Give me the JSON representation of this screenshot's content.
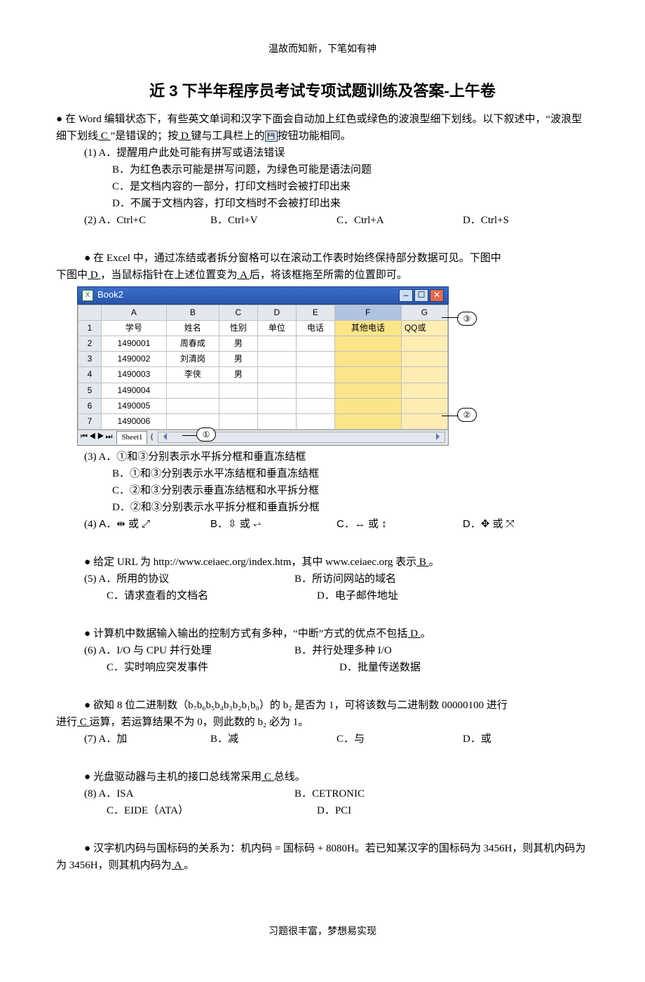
{
  "header_note": "温故而知新，下笔如有神",
  "footer_note": "习题很丰富，梦想易实现",
  "title": "近 3 下半年程序员考试专项试题训练及答案-上午卷",
  "q1": {
    "stem_a": "在 Word 编辑状态下，有些英文单词和汉字下面会自动加上红色或绿色的波浪型细下划线。以下叙述中，“波浪型细下划线",
    "ans1": " C ",
    "stem_b": "”是错误的；按",
    "ans2": " D ",
    "stem_c": "键与工具栏上的",
    "stem_d": "按钮功能相同。",
    "n1": "(1)",
    "a": "A．提醒用户此处可能有拼写或语法错误",
    "b": "B．为红色表示可能是拼写问题，为绿色可能是语法问题",
    "c": "C．是文档内容的一部分，打印文档时会被打印出来",
    "d": "D．不属于文档内容，打印文档时不会被打印出来",
    "n2": "(2)",
    "oa": "A．Ctrl+C",
    "ob": "B．Ctrl+V",
    "oc": "C．Ctrl+A",
    "od": "D．Ctrl+S"
  },
  "q2": {
    "stem_a": "在 Excel 中，通过冻结或者拆分窗格可以在滚动工作表时始终保持部分数据可见。下图中",
    "ans1": " D ",
    "stem_b": "，当鼠标指针在上述位置变为",
    "ans2": " A ",
    "stem_c": "后，将该框拖至所需的位置即可。",
    "excel": {
      "title": "Book2",
      "cols": [
        "A",
        "B",
        "C",
        "D",
        "E",
        "F",
        "G"
      ],
      "header": [
        "学号",
        "姓名",
        "性别",
        "单位",
        "电话",
        "其他电话",
        "QQ或"
      ],
      "rows": [
        [
          "1490001",
          "周春成",
          "男",
          "",
          "",
          "",
          ""
        ],
        [
          "1490002",
          "刘清岗",
          "男",
          "",
          "",
          "",
          ""
        ],
        [
          "1490003",
          "李侠",
          "男",
          "",
          "",
          "",
          ""
        ],
        [
          "1490004",
          "",
          "",
          "",
          "",
          "",
          ""
        ],
        [
          "1490005",
          "",
          "",
          "",
          "",
          "",
          ""
        ],
        [
          "1490006",
          "",
          "",
          "",
          "",
          "",
          ""
        ]
      ],
      "sheet": "Sheet1",
      "c1": "①",
      "c2": "②",
      "c3": "③"
    },
    "n3": "(3)",
    "a": "A．①和③分别表示水平拆分框和垂直冻结框",
    "b": "B．①和③分别表示水平冻结框和垂直冻结框",
    "c": "C．②和③分别表示垂直冻结框和水平拆分框",
    "d": "D．②和③分别表示水平拆分框和垂直拆分框",
    "n4": "(4)",
    "oa": "A．⇹ 或 ⤢",
    "ob": "B．⇳ 或 ⥋",
    "oc": "C．↔ 或 ↕",
    "od": "D．✥ 或 ⤧"
  },
  "q3": {
    "stem_a": "给定 URL 为 http://www.ceiaec.org/index.htm，其中 www.ceiaec.org 表示",
    "ans": " B ",
    "n": "(5)",
    "a": "A．所用的协议",
    "b": "B．所访问网站的域名",
    "c": "C．请求查看的文档名",
    "d": "D．电子邮件地址"
  },
  "q4": {
    "stem_a": "计算机中数据输入输出的控制方式有多种，“中断”方式的优点不包括",
    "ans": " D ",
    "n": "(6)",
    "a": "A．I/O 与 CPU 并行处理",
    "b": "B．并行处理多种 I/O",
    "c": "C．实时响应突发事件",
    "d": "D．批量传送数据"
  },
  "q5": {
    "stem_a": "欲知 8 位二进制数（b₇b₆b₅b₄b₃b₂b₁b₀）的 b₂ 是否为 1，可将该数与二进制数 00000100 进行",
    "ans": " C ",
    "stem_b": "运算，若运算结果不为 0，则此数的 b₂ 必为 1。",
    "n": "(7)",
    "a": "A．加",
    "b": "B．减",
    "c": "C．与",
    "d": "D．或"
  },
  "q6": {
    "stem_a": "光盘驱动器与主机的接口总线常采用",
    "ans": " C ",
    "stem_b": "总线。",
    "n": "(8)",
    "a": "A．ISA",
    "b": "B．CETRONIC",
    "c": "C．EIDE（ATA）",
    "d": "D．PCI"
  },
  "q7": {
    "stem_a": "汉字机内码与国标码的关系为：机内码 = 国标码 + 8080H。若已知某汉字的国标码为 3456H，则其机内码为",
    "ans": " A ",
    "stem_b": "。"
  }
}
